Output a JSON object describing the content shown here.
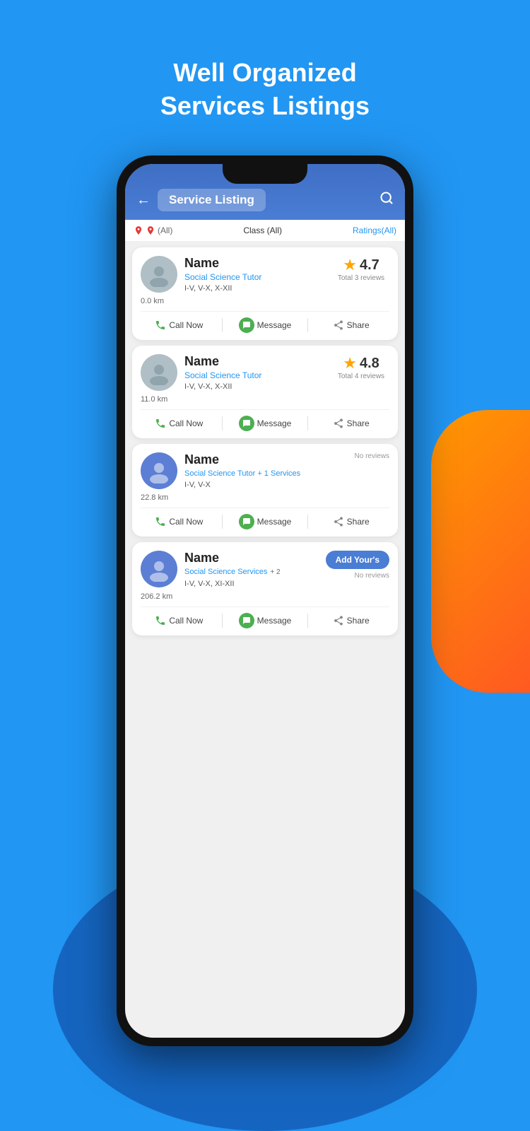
{
  "page": {
    "header_title_line1": "Well Organized",
    "header_title_line2": "Services Listings"
  },
  "app": {
    "screen_title": "Service Listing",
    "back_icon": "←",
    "search_icon": "🔍",
    "filter": {
      "location_label": "(All)",
      "class_label": "Class",
      "class_value": "(All)",
      "ratings_label": "Ratings(All)"
    }
  },
  "listings": [
    {
      "name": "Name",
      "subtitle": "Social Science Tutor",
      "grades": "I-V, V-X, X-XII",
      "distance": "0.0 km",
      "rating": "4.7",
      "total_reviews": "Total 3 reviews",
      "has_rating": true,
      "actions": {
        "call": "Call Now",
        "message": "Message",
        "share": "Share"
      }
    },
    {
      "name": "Name",
      "subtitle": "Social Science Tutor",
      "grades": "I-V, V-X, X-XII",
      "distance": "11.0 km",
      "rating": "4.8",
      "total_reviews": "Total 4 reviews",
      "has_rating": true,
      "actions": {
        "call": "Call Now",
        "message": "Message",
        "share": "Share"
      }
    },
    {
      "name": "Name",
      "subtitle": "Social Science Tutor + 1 Services",
      "grades": "I-V, V-X",
      "distance": "22.8 km",
      "has_rating": false,
      "no_reviews": "No reviews",
      "actions": {
        "call": "Call Now",
        "message": "Message",
        "share": "Share"
      }
    },
    {
      "name": "Name",
      "subtitle": "Social Science Services",
      "grades": "I-V, V-X, XI-XII",
      "distance": "206.2 km",
      "has_rating": false,
      "no_reviews": "No reviews",
      "add_yours_label": "Add Your's",
      "plus_badge": "+ 2",
      "actions": {
        "call": "Call Now",
        "message": "Message",
        "share": "Share"
      }
    }
  ]
}
